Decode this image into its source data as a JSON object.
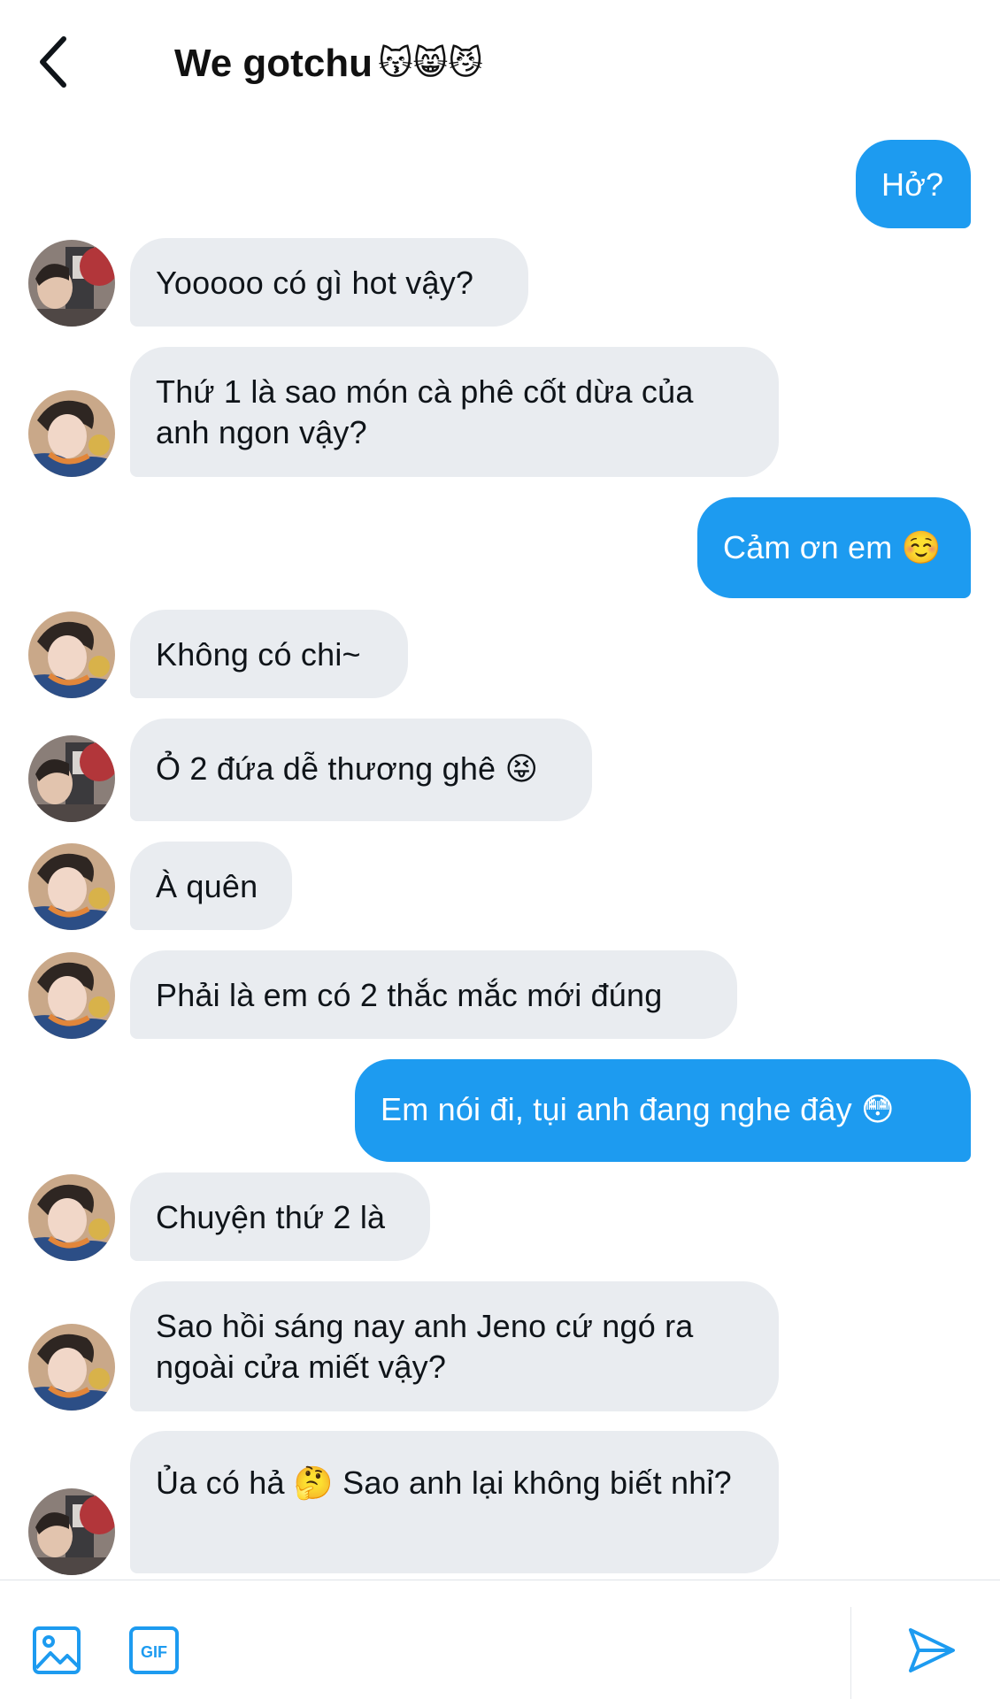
{
  "header": {
    "title": "We gotchu",
    "title_emoji": "😽😸😼"
  },
  "messages": [
    {
      "sender": "me",
      "text": "Hở?"
    },
    {
      "sender": "other",
      "avatar": "avatar-a",
      "text": "Yooooo có gì hot vậy?"
    },
    {
      "sender": "other",
      "avatar": "avatar-b",
      "text": "Thứ 1 là sao món cà phê cốt dừa của anh ngon vậy?"
    },
    {
      "sender": "me",
      "text": "Cảm ơn em ☺️"
    },
    {
      "sender": "other",
      "avatar": "avatar-b",
      "text": "Không có chi~"
    },
    {
      "sender": "other",
      "avatar": "avatar-a",
      "text": "Ỏ 2 đứa dễ thương ghê 😝"
    },
    {
      "sender": "other",
      "avatar": "avatar-b",
      "text": "À quên"
    },
    {
      "sender": "other",
      "avatar": "avatar-b",
      "text": "Phải là em có 2 thắc mắc mới đúng"
    },
    {
      "sender": "me",
      "text": "Em nói đi, tụi anh đang nghe đây 😳"
    },
    {
      "sender": "other",
      "avatar": "avatar-b",
      "text": "Chuyện thứ 2 là"
    },
    {
      "sender": "other",
      "avatar": "avatar-b",
      "text": "Sao hồi sáng nay anh Jeno cứ ngó ra ngoài cửa miết vậy?"
    },
    {
      "sender": "other",
      "avatar": "avatar-a",
      "text": "Ủa có hả 🤔 Sao anh lại không biết nhỉ?"
    }
  ],
  "composer": {
    "gif_label": "GIF",
    "image_icon": "image-icon",
    "send_icon": "send-icon"
  },
  "colors": {
    "outgoing_bubble": "#1d9bf0",
    "incoming_bubble": "#e9ecf0",
    "accent": "#1d9bf0"
  }
}
